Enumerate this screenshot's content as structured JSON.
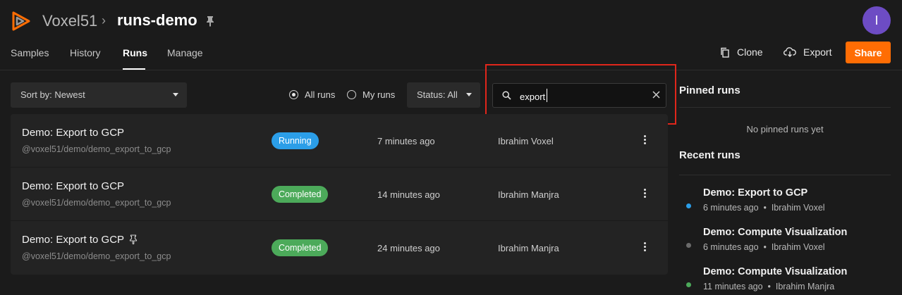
{
  "header": {
    "org": "Voxel51",
    "separator": "›",
    "dataset": "runs-demo",
    "avatar_initial": "I",
    "brand_color": "#ff6d04"
  },
  "tabs": [
    {
      "label": "Samples",
      "active": false
    },
    {
      "label": "History",
      "active": false
    },
    {
      "label": "Runs",
      "active": true
    },
    {
      "label": "Manage",
      "active": false
    }
  ],
  "actions": {
    "clone_label": "Clone",
    "export_label": "Export",
    "share_label": "Share"
  },
  "toolbar": {
    "sort_label": "Sort by: Newest",
    "radio_all": "All runs",
    "radio_mine": "My runs",
    "radio_selected": "All runs",
    "status_label": "Status: All",
    "search_value": "export"
  },
  "runs": [
    {
      "name": "Demo: Export to GCP",
      "path": "@voxel51/demo/demo_export_to_gcp",
      "status": "Running",
      "time": "7 minutes ago",
      "user": "Ibrahim Voxel",
      "pinned": false
    },
    {
      "name": "Demo: Export to GCP",
      "path": "@voxel51/demo/demo_export_to_gcp",
      "status": "Completed",
      "time": "14 minutes ago",
      "user": "Ibrahim Manjra",
      "pinned": false
    },
    {
      "name": "Demo: Export to GCP",
      "path": "@voxel51/demo/demo_export_to_gcp",
      "status": "Completed",
      "time": "24 minutes ago",
      "user": "Ibrahim Manjra",
      "pinned": true
    }
  ],
  "sidebar": {
    "pinned_title": "Pinned runs",
    "pinned_empty": "No pinned runs yet",
    "recent_title": "Recent runs",
    "recent": [
      {
        "name": "Demo: Export to GCP",
        "time": "6 minutes ago",
        "sep": "•",
        "user": "Ibrahim Voxel",
        "dot_color": "#2b9ee8"
      },
      {
        "name": "Demo: Compute Visualization",
        "time": "6 minutes ago",
        "sep": "•",
        "user": "Ibrahim Voxel",
        "dot_color": "#6b6b6b"
      },
      {
        "name": "Demo: Compute Visualization",
        "time": "11 minutes ago",
        "sep": "•",
        "user": "Ibrahim Manjra",
        "dot_color": "#4caa5a"
      }
    ]
  },
  "colors": {
    "running": "#2b9ee8",
    "completed": "#4caa5a",
    "highlight": "#e0261b"
  }
}
